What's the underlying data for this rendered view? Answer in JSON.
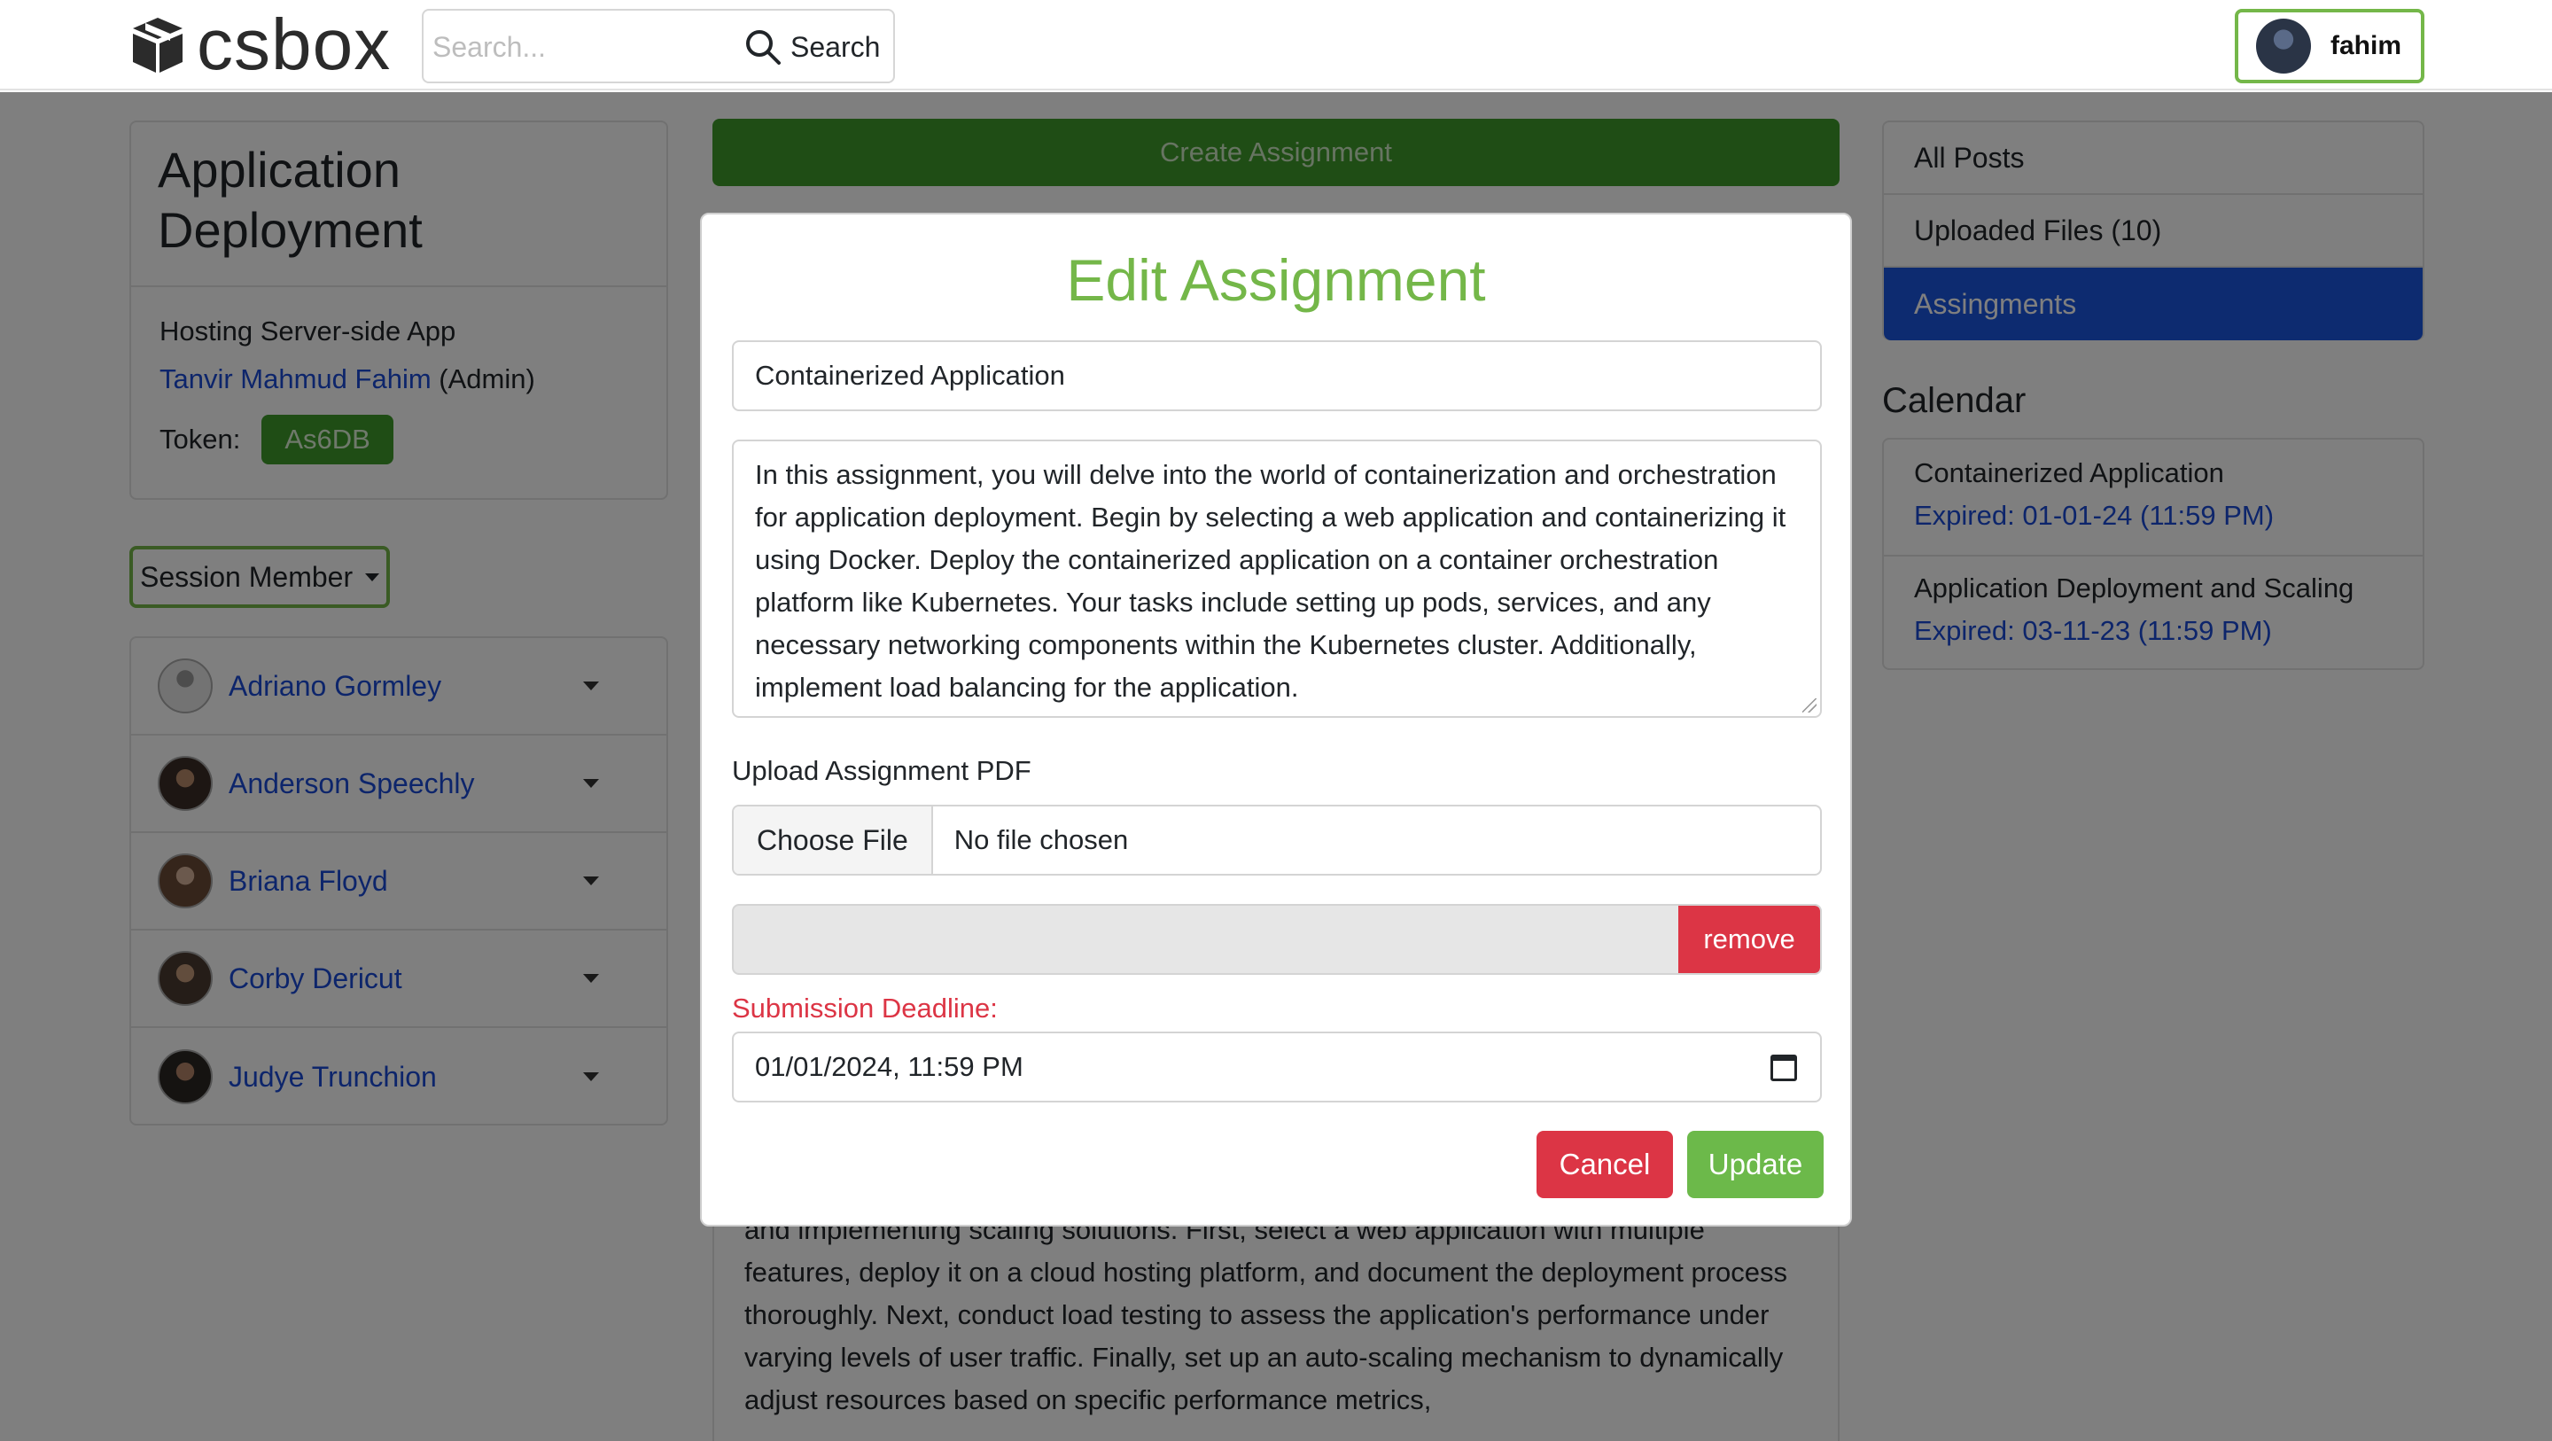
{
  "brand": {
    "name": "csbox"
  },
  "search": {
    "placeholder": "Search...",
    "button_label": "Search"
  },
  "user": {
    "name": "fahim"
  },
  "course": {
    "title": "Application Deployment",
    "subtitle": "Hosting Server-side App",
    "owner_name": "Tanvir Mahmud Fahim",
    "owner_role": "(Admin)",
    "token_label": "Token:",
    "token_value": "As6DB"
  },
  "session": {
    "label": "Session Member"
  },
  "members": [
    {
      "name": "Adriano Gormley"
    },
    {
      "name": "Anderson Speechly"
    },
    {
      "name": "Briana Floyd"
    },
    {
      "name": "Corby Dericut"
    },
    {
      "name": "Judye Trunchion"
    }
  ],
  "main": {
    "create_label": "Create Assignment",
    "post_text": "and implementing scaling solutions. First, select a web application with multiple features, deploy it on a cloud hosting platform, and document the deployment process thoroughly. Next, conduct load testing to assess the application's performance under varying levels of user traffic. Finally, set up an auto-scaling mechanism to dynamically adjust resources based on specific performance metrics,"
  },
  "sidebar": {
    "items": [
      {
        "label": "All Posts"
      },
      {
        "label": "Uploaded Files (10)"
      },
      {
        "label": "Assingments"
      }
    ],
    "active_index": 2
  },
  "calendar": {
    "title": "Calendar",
    "items": [
      {
        "title": "Containerized Application",
        "date": "Expired: 01-01-24 (11:59 PM)"
      },
      {
        "title": "Application Deployment and Scaling",
        "date": "Expired: 03-11-23 (11:59 PM)"
      }
    ]
  },
  "modal": {
    "title": "Edit Assignment",
    "assignment_title": "Containerized Application",
    "description": "In this assignment, you will delve into the world of containerization and orchestration for application deployment. Begin by selecting a web application and containerizing it using Docker. Deploy the containerized application on a container orchestration platform like Kubernetes. Your tasks include setting up pods, services, and any necessary networking components within the Kubernetes cluster. Additionally, implement load balancing for the application.",
    "upload_label": "Upload Assignment PDF",
    "choose_file_label": "Choose File",
    "no_file_text": "No file chosen",
    "remove_label": "remove",
    "deadline_label": "Submission Deadline:",
    "deadline_value": "01/01/2024, 11:59 PM",
    "cancel_label": "Cancel",
    "update_label": "Update"
  },
  "colors": {
    "brand_green": "#74b749",
    "dark_green": "#3f9a2a",
    "link_blue": "#1a4bd6",
    "active_blue": "#1a56e0",
    "danger_red": "#dc3545"
  },
  "icons": {
    "logo": "box-icon",
    "search": "magnifier-icon",
    "calendar": "calendar-icon",
    "caret": "caret-down-icon"
  }
}
